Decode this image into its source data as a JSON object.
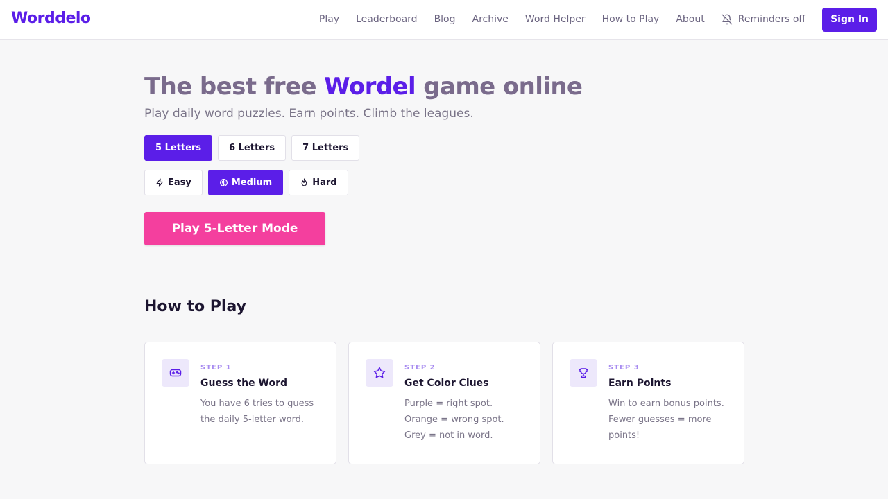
{
  "brand": {
    "name": "Worddelo",
    "accent": "#5b1ee8",
    "cta_color": "#f43f9e"
  },
  "nav": {
    "links": [
      "Play",
      "Leaderboard",
      "Blog",
      "Archive",
      "Word Helper",
      "How to Play",
      "About"
    ],
    "reminders": {
      "label": "Reminders off",
      "icon": "bell-off-icon"
    },
    "signin_label": "Sign In"
  },
  "hero": {
    "title_prefix": "The best free ",
    "title_accent": "Wordel",
    "title_suffix": " game online",
    "subtitle": "Play daily word puzzles. Earn points. Climb the leagues.",
    "lengths": [
      {
        "label": "5 Letters",
        "selected": true
      },
      {
        "label": "6 Letters",
        "selected": false
      },
      {
        "label": "7 Letters",
        "selected": false
      }
    ],
    "difficulties": [
      {
        "label": "Easy",
        "icon": "lightning-icon",
        "selected": false
      },
      {
        "label": "Medium",
        "icon": "brain-icon",
        "selected": true
      },
      {
        "label": "Hard",
        "icon": "flame-icon",
        "selected": false
      }
    ],
    "play_label": "Play 5-Letter Mode"
  },
  "how_to_play": {
    "title": "How to Play",
    "steps": [
      {
        "step": "STEP 1",
        "title": "Guess the Word",
        "icon": "gamepad-icon",
        "lines": [
          "You have 6 tries to guess",
          "the daily 5-letter word."
        ]
      },
      {
        "step": "STEP 2",
        "title": "Get Color Clues",
        "icon": "star-icon",
        "lines": [
          "Purple = right spot.",
          "Orange = wrong spot.",
          "Grey = not in word."
        ]
      },
      {
        "step": "STEP 3",
        "title": "Earn Points",
        "icon": "trophy-icon",
        "lines": [
          "Win to earn bonus points.",
          "Fewer guesses = more",
          "points!"
        ]
      }
    ]
  }
}
